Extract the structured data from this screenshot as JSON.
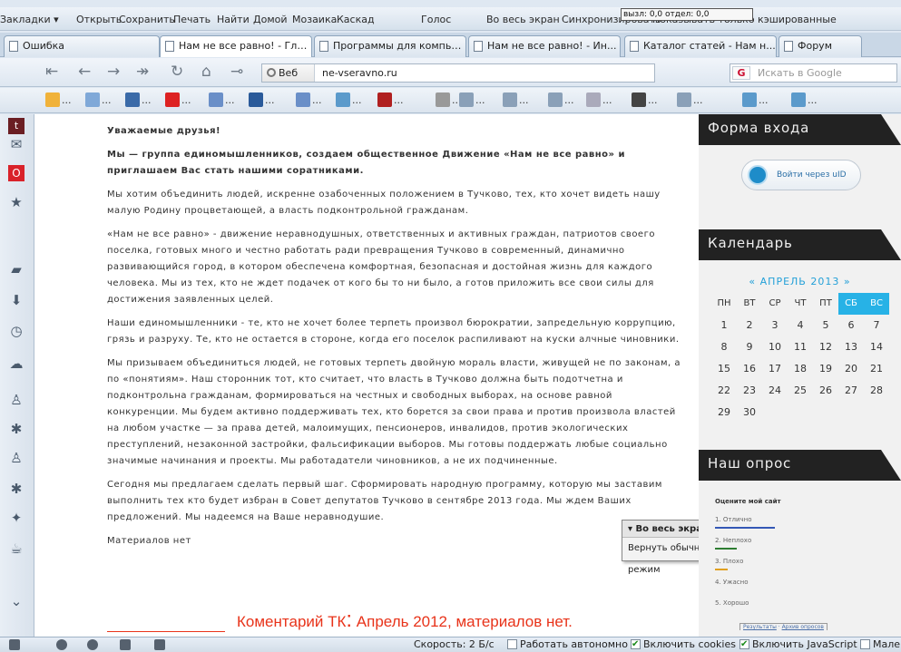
{
  "menubar": {
    "items": [
      "Закладки ▾",
      "Открыть",
      "Сохранить",
      "Печать",
      "Найти",
      "Домой",
      "Мозаика",
      "Каскад",
      "Голос",
      "Во весь экран",
      "Синхронизировать",
      "Показывать только кэшированные"
    ],
    "overlay_tag": "вызл: 0,0 отдел: 0,0"
  },
  "tabs": [
    {
      "label": "Ошибка",
      "active": false
    },
    {
      "label": "Нам не все равно! - Гла...",
      "active": true
    },
    {
      "label": "Программы для компью...",
      "active": false
    },
    {
      "label": "Нам не все равно! - Ин...",
      "active": false
    },
    {
      "label": "Каталог статей - Нам н...",
      "active": false
    },
    {
      "label": "Форум",
      "active": false
    }
  ],
  "navbar": {
    "web_label": "Веб",
    "url": "ne-vseravno.ru",
    "search_placeholder": "Искать в Google"
  },
  "bookmarks": [
    "...",
    "...",
    "...",
    "...",
    "...",
    "...",
    "...",
    "...",
    "...",
    "...",
    "...",
    "...",
    "...",
    "...",
    "...",
    "...",
    "...",
    "..."
  ],
  "bookmark_colors": [
    "#f0b23a",
    "#7fa8d8",
    "#3a6aa8",
    "#d22",
    "#6a8fc8",
    "#2a5a9a",
    "#6a8fc8",
    "#5b9acb",
    "#b02020",
    "#999",
    "#8aa0b8",
    "#8aa0b8",
    "#8aa0b8",
    "#aab",
    "#444",
    "#8aa0b8",
    "#5b9acb",
    "#5b9acb"
  ],
  "article": {
    "p1": "Уважаемые друзья!",
    "p2": "Мы — группа единомышленников, создаем общественное Движение «Нам не все равно» и приглашаем Вас стать нашими соратниками.",
    "p3": "Мы хотим объединить людей, искренне озабоченных положением в Тучково, тех, кто хочет видеть нашу малую Родину процветающей, а власть подконтрольной гражданам.",
    "p4": "«Нам не все равно» - движение неравнодушных, ответственных и активных граждан, патриотов своего поселка, готовых много и честно работать ради превращения Тучково в современный, динамично развивающийся город, в котором обеспечена комфортная, безопасная и достойная жизнь для каждого человека. Мы из тех, кто не ждет подачек от кого бы то ни было, а готов приложить все свои силы для достижения заявленных целей.",
    "p5": "Наши единомышленники - те, кто не хочет более терпеть произвол бюрократии, запредельную коррупцию, грязь и разруху. Те, кто не остается в стороне, когда его поселок распиливают на куски алчные чиновники.",
    "p6": "Мы призываем объединиться людей, не готовых терпеть двойную мораль власти, живущей не по законам, а по «понятиям». Наш сторонник тот, кто считает, что власть в Тучково должна быть подотчетна и подконтрольна гражданам, формироваться на честных и свободных выборах, на основе равной конкуренции. Мы будем активно поддерживать тех, кто борется за свои права и против произвола властей на любом участке — за права детей, малоимущих, пенсионеров, инвалидов, против экологических преступлений, незаконной застройки, фальсификации выборов. Мы готовы поддержать любые социально значимые начинания и проекты. Мы работадатели чиновников, а не их подчиненные.",
    "p7": "Сегодня мы предлагаем сделать первый шаг. Сформировать народную программу, которую мы заставим выполнить тех кто будет избран в Совет депутатов Тучково в сентябре 2013 года. Мы ждем Ваших предложений. Мы надеемся на Ваше неравнодушие.",
    "p8": "Материалов нет"
  },
  "comment": {
    "prefix": "Коментарий ТК",
    "colon": ":",
    "rest": " Апрель 2012, материалов нет."
  },
  "popup": {
    "header": "▾ Во весь экран",
    "item": "Вернуть обычный режим"
  },
  "login": {
    "title": "Форма входа",
    "button": "Войти через uID"
  },
  "calendar": {
    "title": "Календарь",
    "month": "« АПРЕЛЬ 2013 »",
    "days": [
      "ПН",
      "ВТ",
      "СР",
      "ЧТ",
      "ПТ",
      "СБ",
      "ВС"
    ],
    "dates": [
      "1",
      "2",
      "3",
      "4",
      "5",
      "6",
      "7",
      "8",
      "9",
      "10",
      "11",
      "12",
      "13",
      "14",
      "15",
      "16",
      "17",
      "18",
      "19",
      "20",
      "21",
      "22",
      "23",
      "24",
      "25",
      "26",
      "27",
      "28",
      "29",
      "30"
    ]
  },
  "poll": {
    "title": "Наш опрос",
    "question": "Оцените мой сайт",
    "options": [
      "1. Отлично",
      "2. Неплохо",
      "3. Плохо",
      "4. Ужасно",
      "5. Хорошо"
    ],
    "option_colors": [
      "#3357b5",
      "#2e7d32",
      "#e0a020",
      "#999999",
      "#999999"
    ],
    "option_levels": [
      0.55,
      0.2,
      0.12,
      0,
      0
    ],
    "results": "Результаты",
    "archive": "Архив опросов"
  },
  "statusbar": {
    "speed": "Скорость:  2 Б/с",
    "offline": "Работать автономно",
    "cookies": "Включить cookies",
    "javascript": "Включить JavaScript",
    "more": "Мале",
    "offline_on": false,
    "cookies_on": true,
    "javascript_on": true
  },
  "icons": {
    "sidebar": [
      "tumblr-icon",
      "mail-icon",
      "opera-icon",
      "star-icon",
      "notes-icon",
      "download-icon",
      "history-icon",
      "cloud-icon",
      "user-icon",
      "star-box-icon",
      "user-icon",
      "star-box-icon",
      "puzzle-icon",
      "java-icon",
      "expand-icon"
    ]
  }
}
